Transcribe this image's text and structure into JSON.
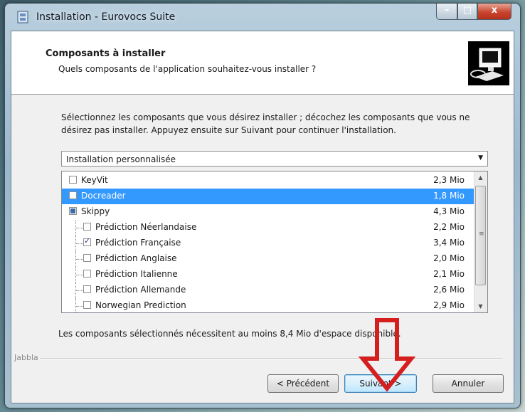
{
  "window": {
    "title": "Installation - Eurovocs Suite",
    "buttons": {
      "minimize": "–",
      "maximize": "□",
      "close": "x"
    }
  },
  "header": {
    "title": "Composants à installer",
    "subtitle": "Quels composants de l'application souhaitez-vous installer ?"
  },
  "description": "Sélectionnez les composants que vous désirez installer ; décochez les composants que vous ne désirez pas installer. Appuyez ensuite sur Suivant pour continuer l'installation.",
  "install_type": {
    "selected": "Installation personnalisée"
  },
  "components": [
    {
      "label": "KeyVit",
      "size": "2,3 Mio",
      "checked": false,
      "indent": 0,
      "selected": false
    },
    {
      "label": "Docreader",
      "size": "1,8 Mio",
      "checked": false,
      "indent": 0,
      "selected": true
    },
    {
      "label": "Skippy",
      "size": "4,3 Mio",
      "checked": "partial",
      "indent": 0,
      "selected": false
    },
    {
      "label": "Prédiction Néerlandaise",
      "size": "2,2 Mio",
      "checked": false,
      "indent": 1,
      "selected": false
    },
    {
      "label": "Prédiction Française",
      "size": "3,4 Mio",
      "checked": true,
      "indent": 1,
      "selected": false
    },
    {
      "label": "Prédiction Anglaise",
      "size": "2,0 Mio",
      "checked": false,
      "indent": 1,
      "selected": false
    },
    {
      "label": "Prédiction Italienne",
      "size": "2,1 Mio",
      "checked": false,
      "indent": 1,
      "selected": false
    },
    {
      "label": "Prédiction Allemande",
      "size": "2,6 Mio",
      "checked": false,
      "indent": 1,
      "selected": false
    },
    {
      "label": "Norwegian Prediction",
      "size": "2,9 Mio",
      "checked": false,
      "indent": 1,
      "selected": false
    }
  ],
  "space_note": "Les composants sélectionnés nécessitent au moins 8,4 Mio d'espace disponible.",
  "brand": "Jabbla",
  "buttons": {
    "back": "< Précédent",
    "next": "Suivant >",
    "cancel": "Annuler"
  },
  "colors": {
    "selection": "#3399ff",
    "annotation_arrow": "#d51f1f"
  }
}
